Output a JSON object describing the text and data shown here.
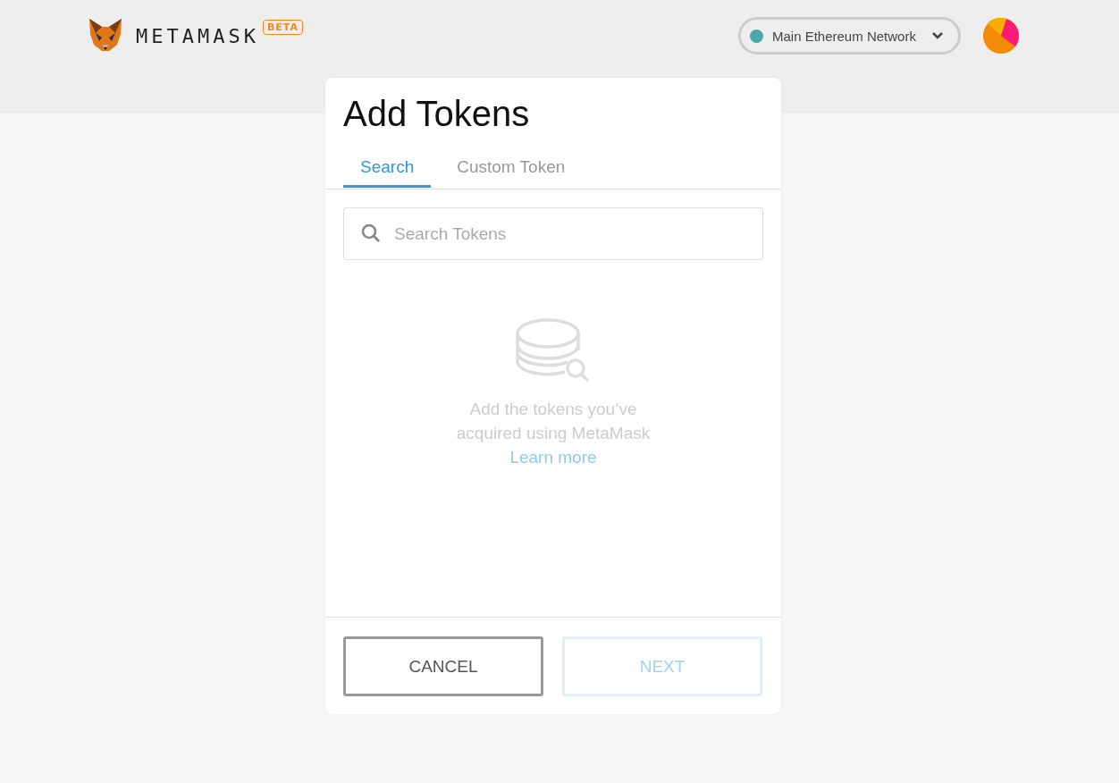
{
  "header": {
    "brand": "METAMASK",
    "badge": "BETA",
    "network": {
      "name": "Main Ethereum Network"
    }
  },
  "dialog": {
    "title": "Add Tokens",
    "tabs": [
      {
        "label": "Search",
        "selected": true
      },
      {
        "label": "Custom Token",
        "selected": false
      }
    ],
    "search": {
      "placeholder": "Search Tokens"
    },
    "empty_state": {
      "lines": [
        "Add the tokens you’ve",
        "acquired using MetaMask"
      ],
      "link": "Learn more"
    },
    "buttons": [
      {
        "label": "CANCEL",
        "disabled": false
      },
      {
        "label": "NEXT",
        "disabled": true
      }
    ]
  }
}
